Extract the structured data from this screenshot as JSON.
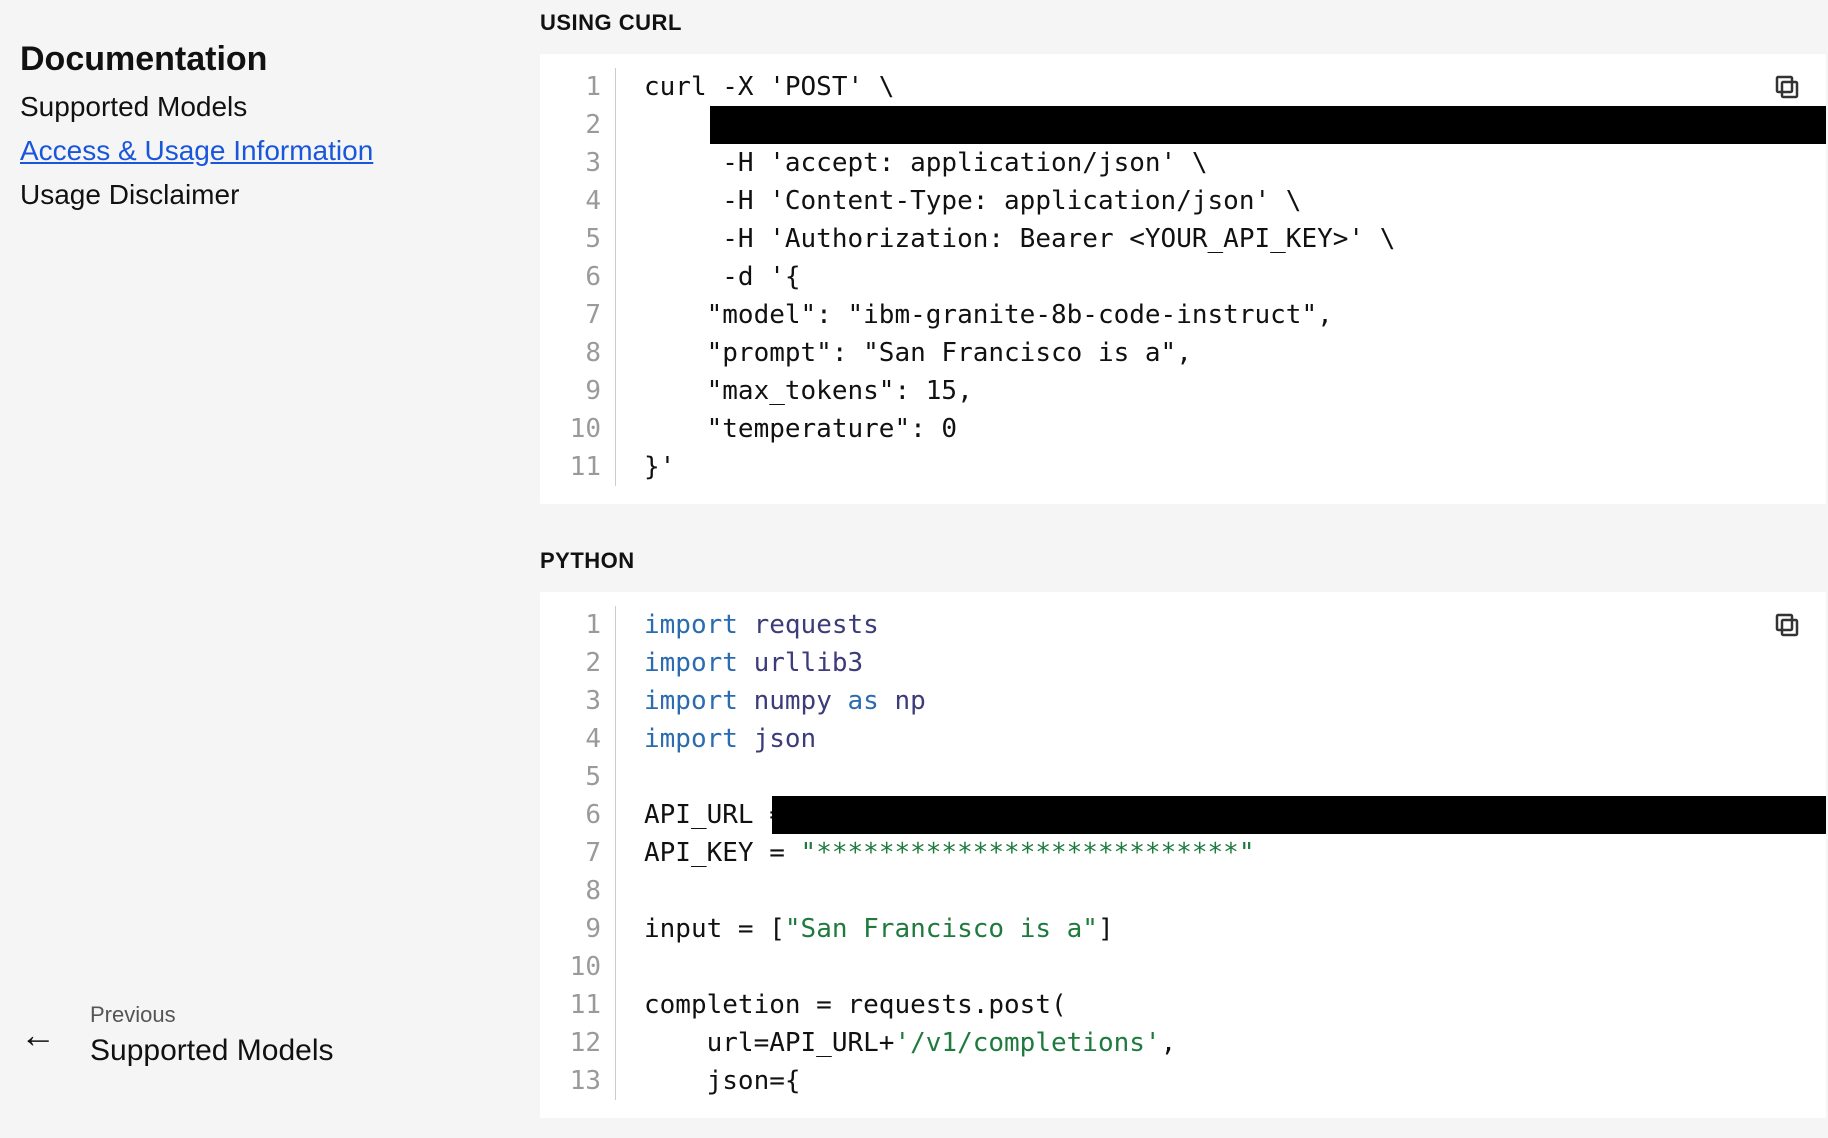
{
  "sidebar": {
    "title": "Documentation",
    "items": [
      {
        "label": "Supported Models",
        "active": false
      },
      {
        "label": "Access & Usage Information",
        "active": true
      },
      {
        "label": "Usage Disclaimer",
        "active": false
      }
    ],
    "prev": {
      "label": "Previous",
      "title": "Supported Models"
    }
  },
  "sections": {
    "curl": {
      "heading": "USING CURL",
      "lines": [
        "curl -X 'POST' \\",
        "     '",
        "     -H 'accept: application/json' \\",
        "     -H 'Content-Type: application/json' \\",
        "     -H 'Authorization: Bearer <YOUR_API_KEY>' \\",
        "     -d '{",
        "    \"model\": \"ibm-granite-8b-code-instruct\",",
        "    \"prompt\": \"San Francisco is a\",",
        "    \"max_tokens\": 15,",
        "    \"temperature\": 0",
        "}'"
      ],
      "redacted_line_index": 1,
      "redaction_start_ch": 6
    },
    "python": {
      "heading": "PYTHON",
      "tokens": [
        [
          {
            "t": "import ",
            "c": "kw"
          },
          {
            "t": "requests",
            "c": "mod"
          }
        ],
        [
          {
            "t": "import ",
            "c": "kw"
          },
          {
            "t": "urllib3",
            "c": "mod"
          }
        ],
        [
          {
            "t": "import ",
            "c": "kw"
          },
          {
            "t": "numpy",
            "c": "mod"
          },
          {
            "t": " as ",
            "c": "kw"
          },
          {
            "t": "np",
            "c": "mod"
          }
        ],
        [
          {
            "t": "import ",
            "c": "kw"
          },
          {
            "t": "json",
            "c": "mod"
          }
        ],
        [
          {
            "t": "",
            "c": "var"
          }
        ],
        [
          {
            "t": "API_URL = ",
            "c": "var"
          }
        ],
        [
          {
            "t": "API_KEY = ",
            "c": "var"
          },
          {
            "t": "\"***************************\"",
            "c": "str"
          }
        ],
        [
          {
            "t": "",
            "c": "var"
          }
        ],
        [
          {
            "t": "input = [",
            "c": "var"
          },
          {
            "t": "\"San Francisco is a\"",
            "c": "str"
          },
          {
            "t": "]",
            "c": "var"
          }
        ],
        [
          {
            "t": "",
            "c": "var"
          }
        ],
        [
          {
            "t": "completion = requests.post(",
            "c": "var"
          }
        ],
        [
          {
            "t": "    url=API_URL+",
            "c": "var"
          },
          {
            "t": "'/v1/completions'",
            "c": "str"
          },
          {
            "t": ",",
            "c": "var"
          }
        ],
        [
          {
            "t": "    json={",
            "c": "var"
          }
        ]
      ],
      "redacted_line_index": 5,
      "redaction_start_ch": 10
    }
  }
}
